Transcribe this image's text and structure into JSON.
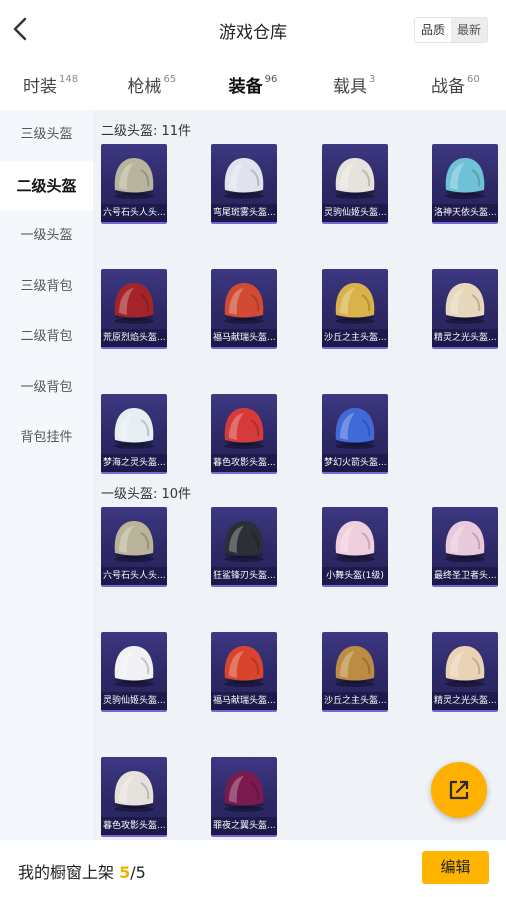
{
  "header": {
    "title": "游戏仓库",
    "sort_options": [
      "品质",
      "最新"
    ],
    "active_sort": 1
  },
  "tabs": [
    {
      "label": "时装",
      "count": "148"
    },
    {
      "label": "枪械",
      "count": "65"
    },
    {
      "label": "装备",
      "count": "96",
      "active": true
    },
    {
      "label": "载具",
      "count": "3"
    },
    {
      "label": "战备",
      "count": "60"
    }
  ],
  "sidebar": {
    "items": [
      "三级头盔",
      "二级头盔",
      "一级头盔",
      "三级背包",
      "二级背包",
      "一级背包",
      "背包挂件"
    ],
    "active_index": 1
  },
  "sections": [
    {
      "title": "二级头盔: 11件",
      "items": [
        {
          "name": "六号石头人头...",
          "color": "#b8b59c",
          "icon": "helmet-icon"
        },
        {
          "name": "弯尾斑雾头盔...",
          "color": "#dfe3ec",
          "icon": "helmet-icon"
        },
        {
          "name": "灵驹仙姬头盔...",
          "color": "#e7e3dc",
          "icon": "helmet-icon"
        },
        {
          "name": "洛神天依头盔...",
          "color": "#6fc2d6",
          "icon": "helmet-icon"
        },
        {
          "name": "荒原烈焰头盔...",
          "color": "#a5242a",
          "icon": "helmet-icon"
        },
        {
          "name": "福马献瑞头盔...",
          "color": "#d24a33",
          "icon": "helmet-icon"
        },
        {
          "name": "沙丘之主头盔...",
          "color": "#d9b24a",
          "icon": "helmet-icon"
        },
        {
          "name": "精灵之光头盔...",
          "color": "#e7d7bc",
          "icon": "helmet-icon"
        },
        {
          "name": "梦海之灵头盔...",
          "color": "#e6eef3",
          "icon": "helmet-icon"
        },
        {
          "name": "暮色攻影头盔...",
          "color": "#d63a3a",
          "icon": "helmet-icon"
        },
        {
          "name": "梦幻火箭头盔...",
          "color": "#3f6ad8",
          "icon": "helmet-icon"
        }
      ]
    },
    {
      "title": "一级头盔: 10件",
      "items": [
        {
          "name": "六号石头人头...",
          "color": "#b9b49a",
          "icon": "helmet-icon"
        },
        {
          "name": "狂鲨锋刃头盔...",
          "color": "#2b3038",
          "icon": "helmet-icon"
        },
        {
          "name": "小舞头盔(1级)",
          "color": "#f0cfdc",
          "icon": "helmet-icon"
        },
        {
          "name": "最终圣卫者头...",
          "color": "#e9c9dc",
          "icon": "helmet-icon"
        },
        {
          "name": "灵驹仙姬头盔...",
          "color": "#f1f1f4",
          "icon": "helmet-icon"
        },
        {
          "name": "福马献瑞头盔...",
          "color": "#d8452c",
          "icon": "helmet-icon"
        },
        {
          "name": "沙丘之主头盔...",
          "color": "#bc8c44",
          "icon": "helmet-icon"
        },
        {
          "name": "精灵之光头盔...",
          "color": "#ead2b5",
          "icon": "helmet-icon"
        },
        {
          "name": "暮色攻影头盔...",
          "color": "#e6e1dc",
          "icon": "helmet-icon"
        },
        {
          "name": "罪夜之翼头盔...",
          "color": "#7a1a4e",
          "icon": "helmet-icon"
        }
      ]
    }
  ],
  "fab": {
    "icon": "share-out-icon"
  },
  "bottom_bar": {
    "shelf_label": "我的橱窗上架",
    "shelf_current": "5",
    "shelf_total": "/5",
    "edit_label": "编辑"
  },
  "colors": {
    "accent": "#ffb400",
    "card_bg": "#2f2b6b",
    "card_rarity": "#7e62d6"
  }
}
